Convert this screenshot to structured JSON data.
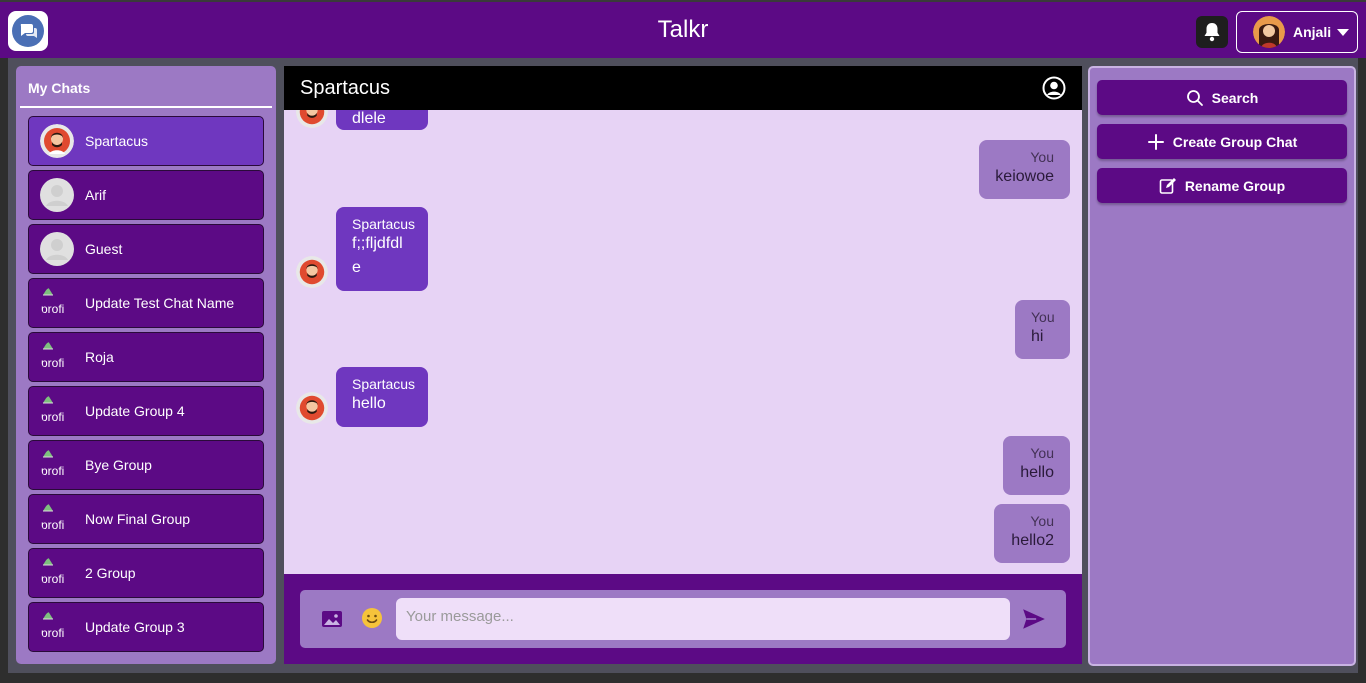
{
  "app": {
    "title": "Talkr"
  },
  "user": {
    "name": "Anjali"
  },
  "sidebar": {
    "title": "My Chats",
    "chats": [
      {
        "name": "Spartacus",
        "avatar": "spartacus-avatar",
        "active": true
      },
      {
        "name": "Arif",
        "avatar": "default-user-avatar"
      },
      {
        "name": "Guest",
        "avatar": "default-user-avatar"
      },
      {
        "name": "Update Test Chat Name",
        "avatar": "broken-image",
        "alt": "profi"
      },
      {
        "name": "Roja",
        "avatar": "broken-image",
        "alt": "profi"
      },
      {
        "name": "Update Group 4",
        "avatar": "broken-image",
        "alt": "profi"
      },
      {
        "name": "Bye Group",
        "avatar": "broken-image",
        "alt": "profi"
      },
      {
        "name": "Now Final Group",
        "avatar": "broken-image",
        "alt": "profi"
      },
      {
        "name": "2 Group",
        "avatar": "broken-image",
        "alt": "profi"
      },
      {
        "name": "Update Group 3",
        "avatar": "broken-image",
        "alt": "profi"
      }
    ]
  },
  "chat": {
    "header": "Spartacus",
    "messages": [
      {
        "direction": "in",
        "sender": "",
        "text": "dlele"
      },
      {
        "direction": "out",
        "sender": "You",
        "text": "keiowoe"
      },
      {
        "direction": "in",
        "sender": "Spartacus",
        "text": "f;;fljdfdl e"
      },
      {
        "direction": "out",
        "sender": "You",
        "text": "hi"
      },
      {
        "direction": "in",
        "sender": "Spartacus",
        "text": "hello"
      },
      {
        "direction": "out",
        "sender": "You",
        "text": "hello"
      },
      {
        "direction": "out",
        "sender": "You",
        "text": "hello2"
      }
    ],
    "composer": {
      "placeholder": "Your message..."
    }
  },
  "actions": {
    "search": "Search",
    "create_group": "Create Group Chat",
    "rename_group": "Rename Group"
  },
  "colors": {
    "brand": "#5c0a85",
    "panel": "#9c79c4",
    "active": "#6f37bf",
    "chat_bg": "#e7d3f5"
  }
}
